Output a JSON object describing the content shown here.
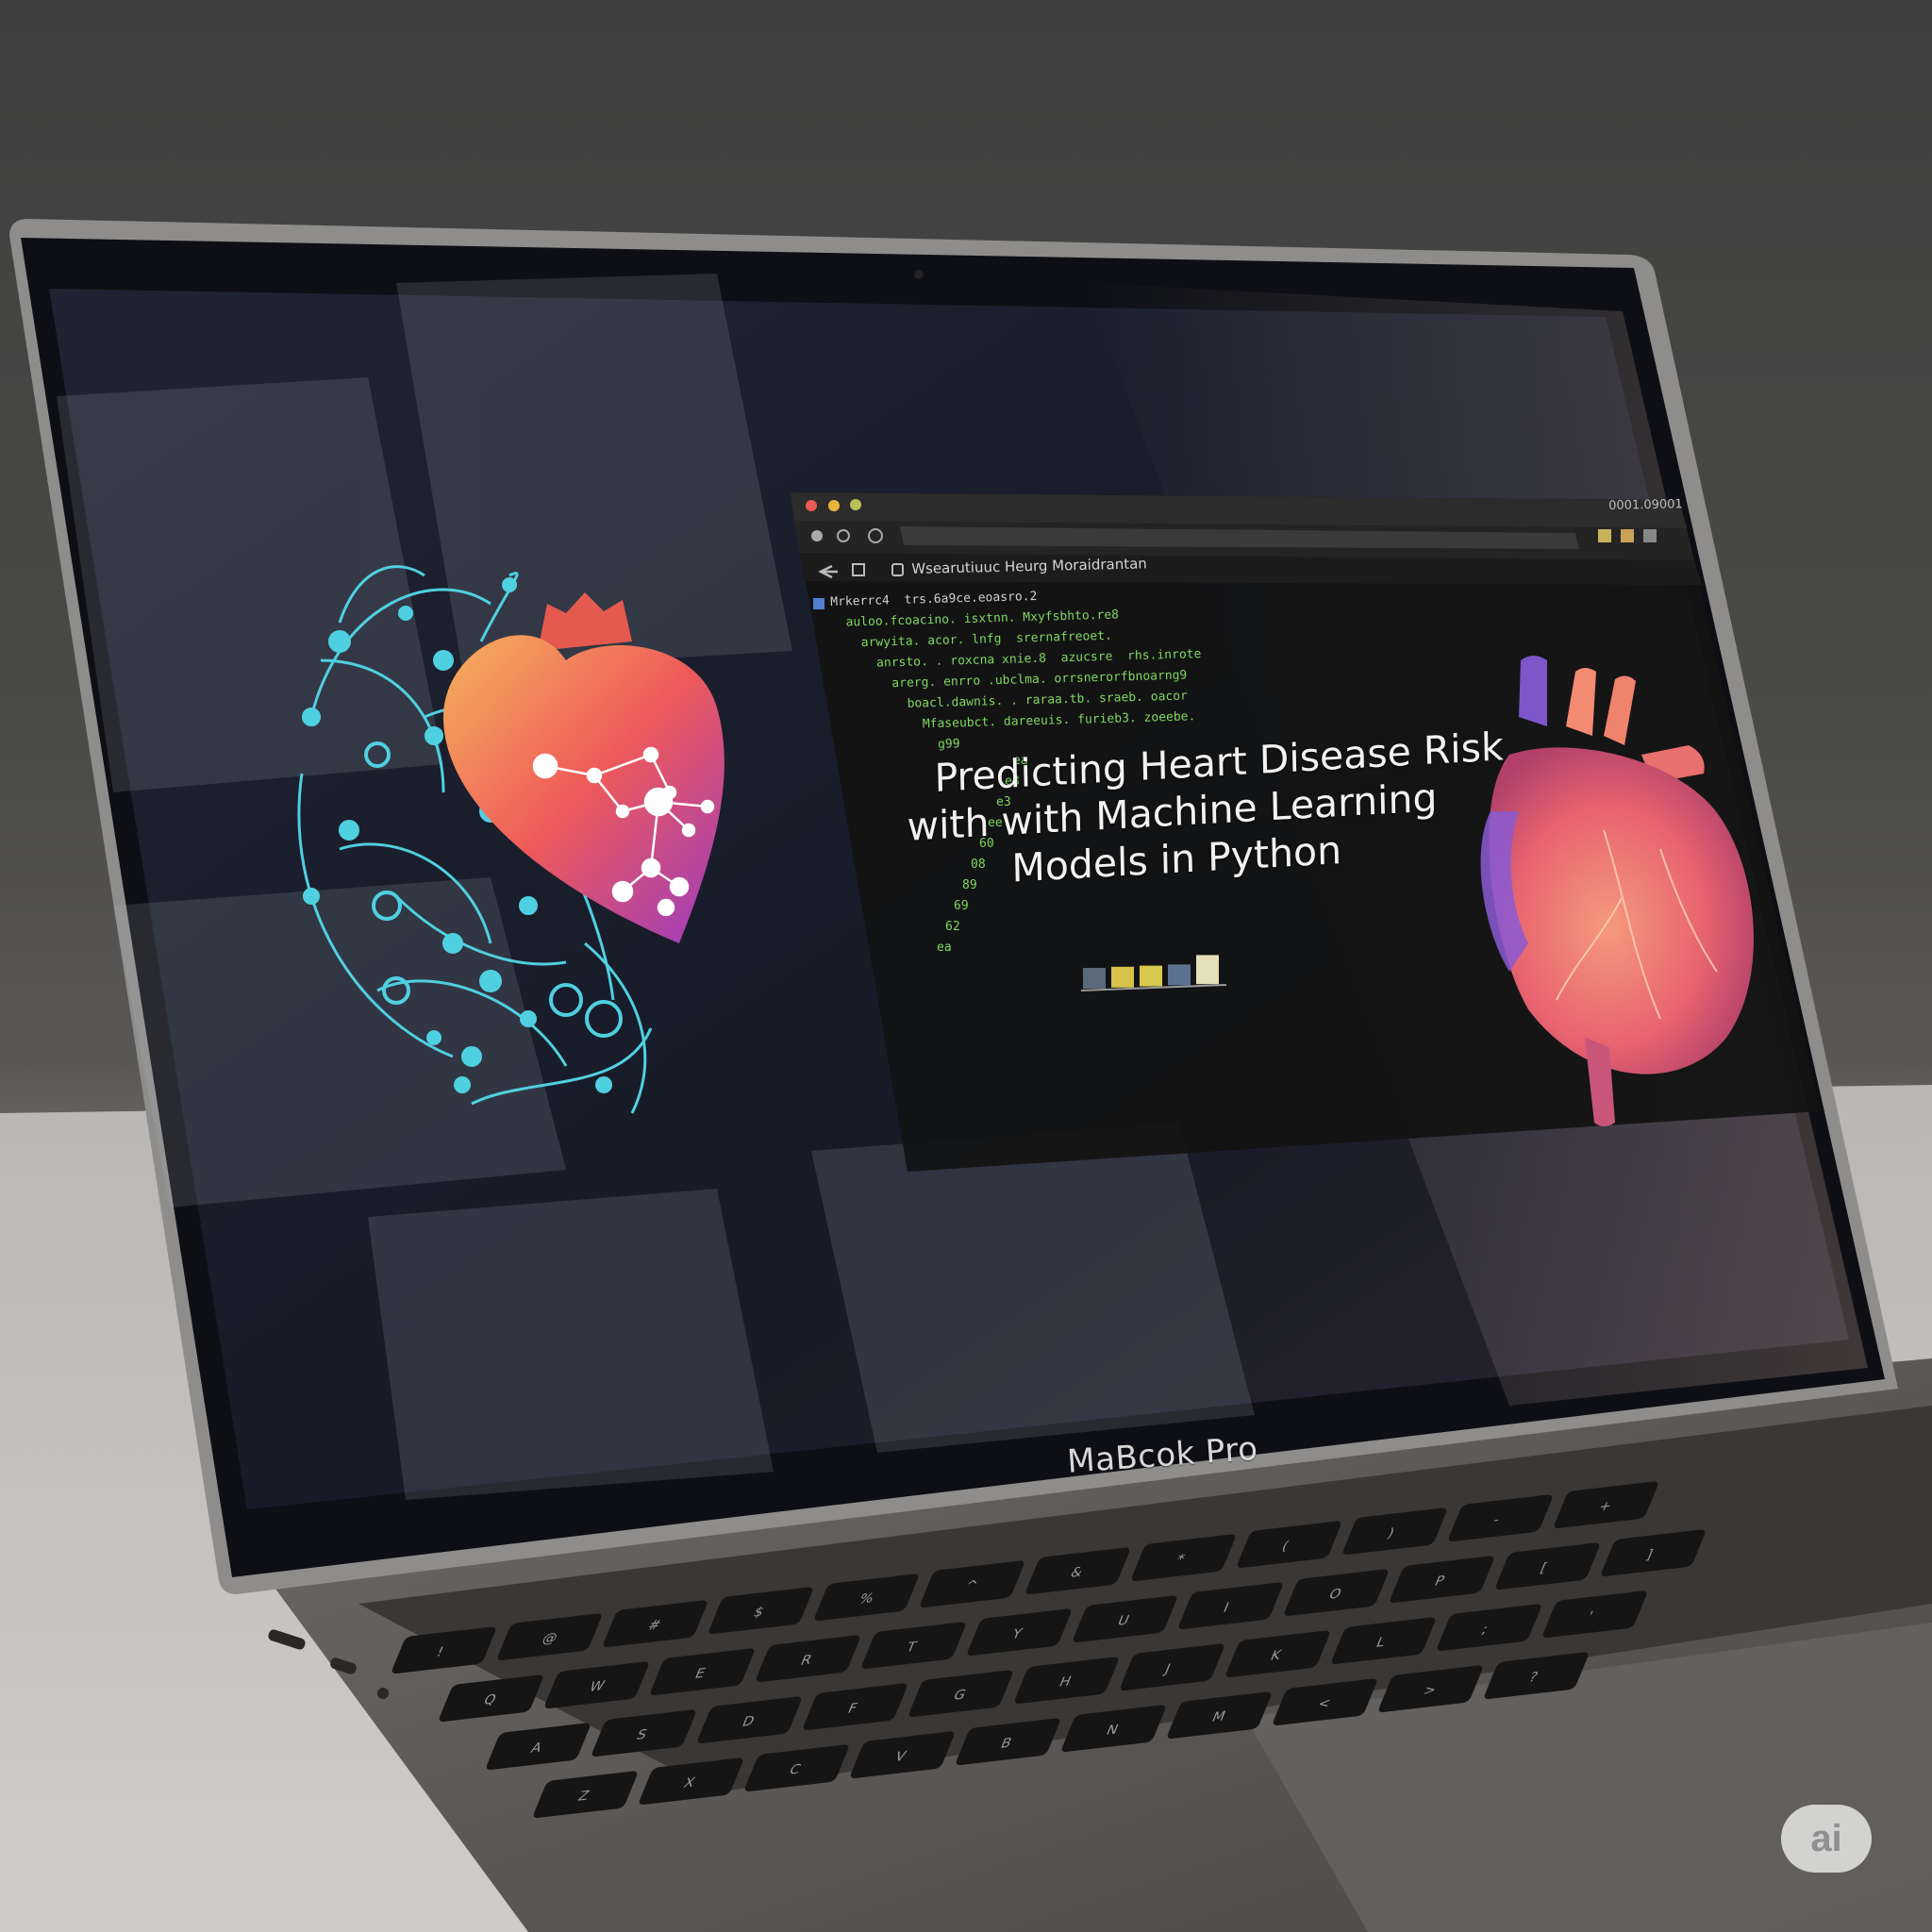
{
  "screen": {
    "tab_title": "Wsearutiuuc Heurg Moraidrantan",
    "tab_right": "0001.09001",
    "code_lines": [
      "Mrkerrc4  trs.6a9ce.eoasro.2",
      "  auloo.fcoacino. isxtnn. Mxyfsbhto.re8",
      "    arwyita. acor. lnfg  srernafreoet.",
      "      anrsto. . roxcna xnie.8  azucsre  rhs.inrote",
      "        arerg. enrro .ubclma. orrsnerorfbnoarng9",
      "          boacl.dawnis. . raraa.tb. sraeb. oacor",
      "            Mfaseubct. dareeuis. furieb3. zoeebe.",
      "              g99"
    ],
    "gutter_lines": [
      "ea",
      "e8",
      "e3",
      "ee",
      "60",
      "08",
      "89",
      "69",
      "62",
      "ea"
    ],
    "title_lines": [
      "Predicting Heart Disease Risk",
      "with with Machine Learning",
      "Models in Python"
    ],
    "bar_values": [
      1,
      1,
      1,
      1,
      1.4
    ],
    "bar_colors": [
      "#5b6a7a",
      "#d8c24a",
      "#d8c84e",
      "#5a7290",
      "#e4dfb8"
    ]
  },
  "laptop": {
    "brand_label": "MaBcok Pro"
  },
  "watermark": {
    "label": "ai"
  },
  "colors": {
    "screen_bg": "#1b1e2b",
    "window_bg": "#141414",
    "network_line": "#4fd0e0",
    "heart_gradient_start": "#f3a15a",
    "heart_gradient_end": "#9b3bc0",
    "code_green": "#7fd860"
  },
  "keyboard": {
    "row1": [
      "!",
      "@",
      "#",
      "$",
      "%",
      "^",
      "&",
      "*",
      "(",
      ")",
      "-",
      "+"
    ],
    "row2": [
      "Q",
      "W",
      "E",
      "R",
      "T",
      "Y",
      "U",
      "I",
      "O",
      "P",
      "[",
      "]"
    ],
    "row3": [
      "A",
      "S",
      "D",
      "F",
      "G",
      "H",
      "J",
      "K",
      "L",
      ";",
      "'"
    ],
    "row4": [
      "Z",
      "X",
      "C",
      "V",
      "B",
      "N",
      "M",
      "<",
      ">",
      "?"
    ]
  }
}
